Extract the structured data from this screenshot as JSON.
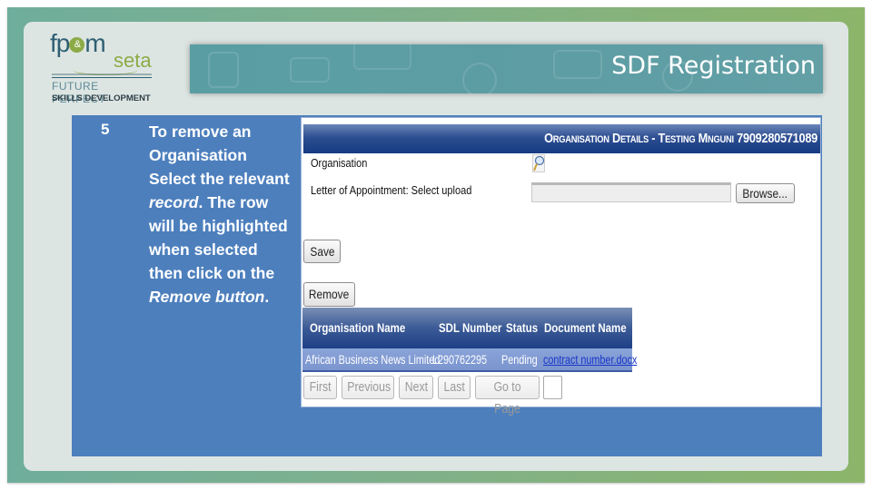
{
  "slide": {
    "title": "SDF Registration",
    "logo": {
      "brand_left": "fp",
      "brand_amp": "&",
      "brand_right": "m",
      "brand_sub": "seta",
      "line1": "FUTURE PERFECT",
      "line2": "SKILLS DEVELOPMENT"
    },
    "colors": {
      "frame_left": "#6fae9c",
      "frame_right": "#8db56a",
      "banner": "#5d9da3",
      "content_blue": "#4d7fbd"
    }
  },
  "step": {
    "number": "5",
    "text_parts": [
      "To remove an Organisation Select the relevant ",
      "record",
      ". The row will be highlighted when selected then click on the ",
      "Remove button",
      "."
    ]
  },
  "app": {
    "header_title": "Organisation Details - Testing Mnguni 7909280571089",
    "fields": {
      "organisation_label": "Organisation",
      "letter_label": "Letter of Appointment: Select upload",
      "letter_value": "",
      "browse_label": "Browse..."
    },
    "buttons": {
      "save": "Save",
      "remove": "Remove"
    },
    "grid": {
      "columns": [
        "Organisation Name",
        "SDL Number",
        "Status",
        "Document Name"
      ],
      "rows": [
        {
          "organisation_name": "African Business News Limited",
          "sdl_number": "L290762295",
          "status": "Pending",
          "document_name": "contract number.docx",
          "selected": true
        }
      ]
    },
    "pager": {
      "first": "First",
      "previous": "Previous",
      "next": "Next",
      "last": "Last",
      "go_to_page": "Go to Page",
      "page_value": ""
    }
  }
}
